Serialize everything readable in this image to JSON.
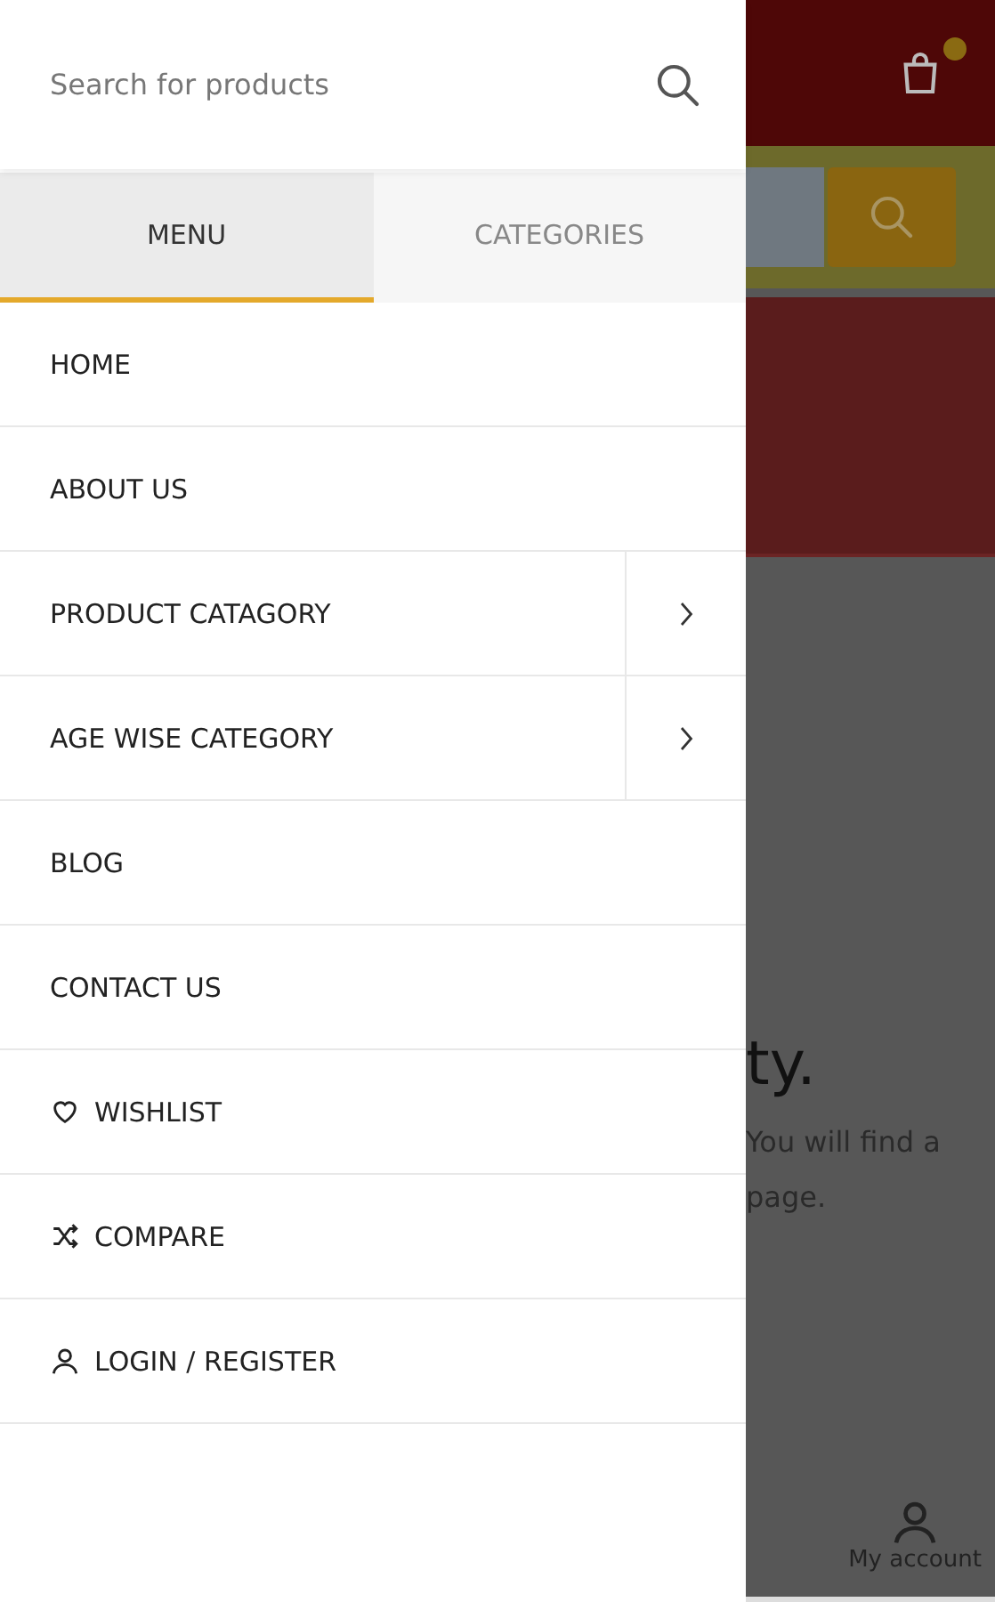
{
  "drawer": {
    "search": {
      "placeholder": "Search for products"
    },
    "tabs": [
      {
        "label": "MENU",
        "selected": true
      },
      {
        "label": "CATEGORIES",
        "selected": false
      }
    ],
    "items": [
      {
        "label": "HOME",
        "kind": "link",
        "has_submenu": false
      },
      {
        "label": "ABOUT US",
        "kind": "link",
        "has_submenu": false
      },
      {
        "label": "PRODUCT CATAGORY",
        "kind": "link",
        "has_submenu": true
      },
      {
        "label": "AGE WISE CATEGORY",
        "kind": "link",
        "has_submenu": true
      },
      {
        "label": "BLOG",
        "kind": "link",
        "has_submenu": false
      },
      {
        "label": "CONTACT US",
        "kind": "link",
        "has_submenu": false
      },
      {
        "label": "WISHLIST",
        "kind": "wishlist",
        "has_submenu": false
      },
      {
        "label": "COMPARE",
        "kind": "compare",
        "has_submenu": false
      },
      {
        "label": "LOGIN / REGISTER",
        "kind": "account",
        "has_submenu": false
      }
    ]
  },
  "page": {
    "heading": "ty.",
    "text_lines": [
      "You will find a",
      "page."
    ],
    "bottom_bar": {
      "label": "My account"
    }
  }
}
